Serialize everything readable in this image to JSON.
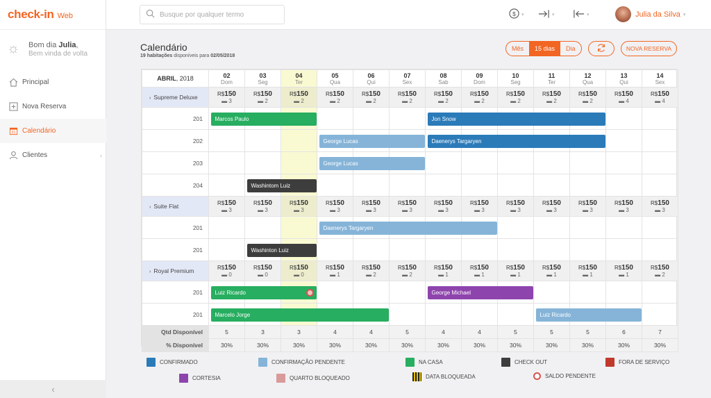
{
  "app": {
    "brand": "check-in",
    "suffix": "Web"
  },
  "sidebar": {
    "greeting_prefix": "Bom dia",
    "greeting_name": "Julia",
    "welcome": "Bem vinda de volta",
    "items": [
      {
        "label": "Principal",
        "icon": "home-icon"
      },
      {
        "label": "Nova Reserva",
        "icon": "plus-square-icon"
      },
      {
        "label": "Calendário",
        "icon": "calendar-icon",
        "active": true
      },
      {
        "label": "Clientes",
        "icon": "user-icon"
      }
    ],
    "collapse_glyph": "‹"
  },
  "topbar": {
    "search_placeholder": "Busque por qualquer termo",
    "user_name": "Julia da Silva"
  },
  "page": {
    "title": "Calendário",
    "subtitle_count": "19 habitações",
    "subtitle_mid": "disponíveis para",
    "subtitle_date": "02/05/2018",
    "views": [
      "Mês",
      "15 dias",
      "Dia"
    ],
    "active_view": "15 dias",
    "new_button": "NOVA RESERVA"
  },
  "calendar": {
    "month": "ABRIL",
    "year": "2018",
    "currency": "R$",
    "days": [
      {
        "num": "02",
        "name": "Dom"
      },
      {
        "num": "03",
        "name": "Seg"
      },
      {
        "num": "04",
        "name": "Ter",
        "today": true
      },
      {
        "num": "05",
        "name": "Qua"
      },
      {
        "num": "06",
        "name": "Qui"
      },
      {
        "num": "07",
        "name": "Sex"
      },
      {
        "num": "08",
        "name": "Sab"
      },
      {
        "num": "09",
        "name": "Dom"
      },
      {
        "num": "10",
        "name": "Seg"
      },
      {
        "num": "11",
        "name": "Ter"
      },
      {
        "num": "12",
        "name": "Qua"
      },
      {
        "num": "13",
        "name": "Qui"
      },
      {
        "num": "14",
        "name": "Sex"
      }
    ],
    "categories": [
      {
        "name": "Supreme Deluxe",
        "price": "150",
        "avail": [
          3,
          2,
          2,
          2,
          2,
          2,
          2,
          2,
          2,
          2,
          2,
          4,
          4
        ],
        "rooms": [
          "201",
          "202",
          "203",
          "204"
        ]
      },
      {
        "name": "Suite Flat",
        "price": "150",
        "avail": [
          3,
          3,
          3,
          3,
          3,
          3,
          3,
          3,
          3,
          3,
          3,
          3,
          3
        ],
        "rooms": [
          "201",
          "201"
        ]
      },
      {
        "name": "Royal Premium",
        "price": "150",
        "avail": [
          0,
          0,
          0,
          1,
          2,
          2,
          1,
          1,
          1,
          1,
          1,
          1,
          2
        ],
        "rooms": [
          "201",
          "201"
        ]
      }
    ],
    "reservations": [
      {
        "guest": "Marcos Paulo",
        "row": 0,
        "start": 0,
        "end": 3,
        "status": "na-casa"
      },
      {
        "guest": "Jon Snow",
        "row": 0,
        "start": 6,
        "end": 11,
        "status": "confirmado"
      },
      {
        "guest": "George Lucas",
        "row": 1,
        "start": 3,
        "end": 6,
        "status": "pendente"
      },
      {
        "guest": "Daenerys Targaryen",
        "row": 1,
        "start": 6,
        "end": 11,
        "status": "confirmado"
      },
      {
        "guest": "George Lucas",
        "row": 2,
        "start": 3,
        "end": 6,
        "status": "pendente"
      },
      {
        "guest": "Washintom Luiz",
        "row": 3,
        "start": 1,
        "end": 3,
        "status": "check-out"
      },
      {
        "guest": "Daenerys Targaryen",
        "row": 4,
        "start": 3,
        "end": 8,
        "status": "pendente"
      },
      {
        "guest": "Washinton Luiz",
        "row": 5,
        "start": 1,
        "end": 3,
        "status": "check-out"
      },
      {
        "guest": "Luiz Ricardo",
        "row": 6,
        "start": 0,
        "end": 3,
        "status": "na-casa",
        "saldo_pendente": true
      },
      {
        "guest": "George Michael",
        "row": 6,
        "start": 6,
        "end": 9,
        "status": "cortesia"
      },
      {
        "guest": "Marcelo Jorge",
        "row": 7,
        "start": 0,
        "end": 5,
        "status": "na-casa"
      },
      {
        "guest": "Luiz Ricardo",
        "row": 7,
        "start": 9,
        "end": 12,
        "status": "pendente"
      }
    ],
    "footer": {
      "qtd_label": "Qtd Disponível",
      "pct_label": "% Disponível",
      "qtd": [
        5,
        3,
        3,
        4,
        4,
        5,
        4,
        4,
        5,
        5,
        5,
        6,
        7
      ],
      "pct": [
        "30%",
        "30%",
        "30%",
        "30%",
        "30%",
        "30%",
        "30%",
        "30%",
        "30%",
        "30%",
        "30%",
        "30%",
        "30%"
      ]
    }
  },
  "colors": {
    "accent": "#f26522",
    "confirmado": "#2b7bb9",
    "pendente": "#85b4d8",
    "na-casa": "#27ae60",
    "check-out": "#3d3d3d",
    "fora": "#c0392b",
    "cortesia": "#8e44ad",
    "bloqueado": "#d99a9a"
  },
  "legend": [
    {
      "label": "CONFIRMADO",
      "key": "confirmado"
    },
    {
      "label": "CONFIRMAÇÃO PENDENTE",
      "key": "pendente"
    },
    {
      "label": "NA CASA",
      "key": "na-casa"
    },
    {
      "label": "CHECK OUT",
      "key": "check-out"
    },
    {
      "label": "FORA DE SERVIÇO",
      "key": "fora"
    },
    {
      "label": "CORTESIA",
      "key": "cortesia"
    },
    {
      "label": "QUARTO BLOQUEADO",
      "key": "bloqueado"
    },
    {
      "label": "DATA BLOQUEADA",
      "key": "data-bloqueada"
    },
    {
      "label": "SALDO PENDENTE",
      "key": "saldo-pendente"
    }
  ]
}
